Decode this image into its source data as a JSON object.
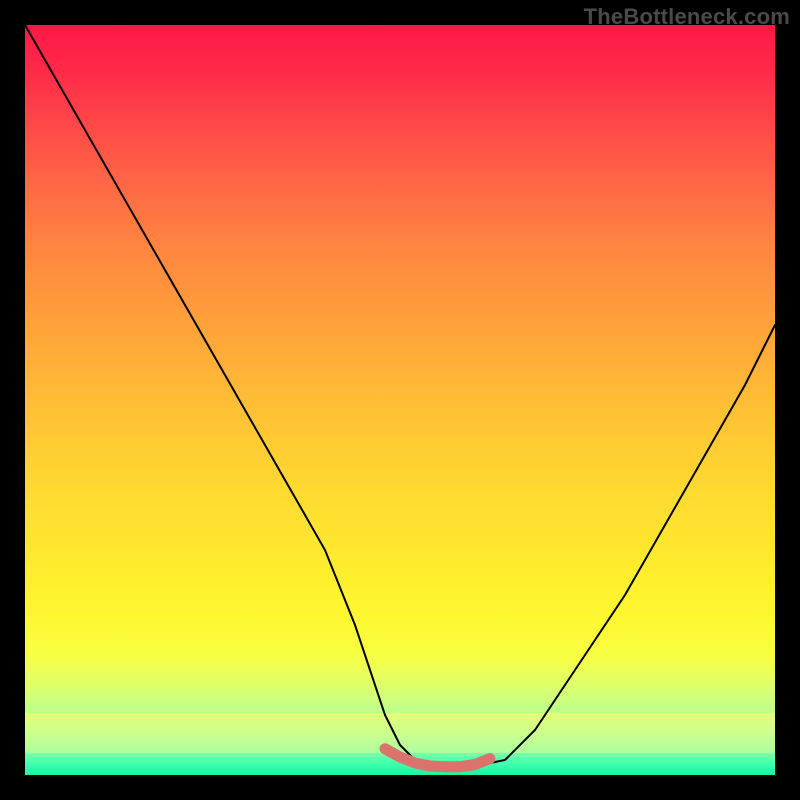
{
  "watermark": "TheBottleneck.com",
  "chart_data": {
    "type": "line",
    "title": "",
    "xlabel": "",
    "ylabel": "",
    "xlim": [
      0,
      100
    ],
    "ylim": [
      0,
      100
    ],
    "grid": false,
    "legend": false,
    "series": [
      {
        "name": "bottleneck-curve",
        "x": [
          0,
          4,
          8,
          12,
          16,
          20,
          24,
          28,
          32,
          36,
          40,
          44,
          46,
          48,
          50,
          52,
          54,
          56,
          58,
          60,
          64,
          68,
          72,
          76,
          80,
          84,
          88,
          92,
          96,
          100
        ],
        "y": [
          100,
          93,
          86,
          79,
          72,
          65,
          58,
          51,
          44,
          37,
          30,
          20,
          14,
          8,
          4,
          2,
          1.2,
          1,
          1,
          1.2,
          2,
          6,
          12,
          18,
          24,
          31,
          38,
          45,
          52,
          60
        ]
      },
      {
        "name": "sweet-spot-band",
        "x": [
          48,
          50,
          52,
          54,
          56,
          58,
          60,
          62
        ],
        "y": [
          3.5,
          2.4,
          1.6,
          1.2,
          1.1,
          1.1,
          1.4,
          2.2
        ]
      }
    ],
    "colors": {
      "curve": "#000000",
      "sweet_spot": "#d9736b",
      "gradient_top": "#ff1846",
      "gradient_bottom": "#17f5a4"
    }
  }
}
